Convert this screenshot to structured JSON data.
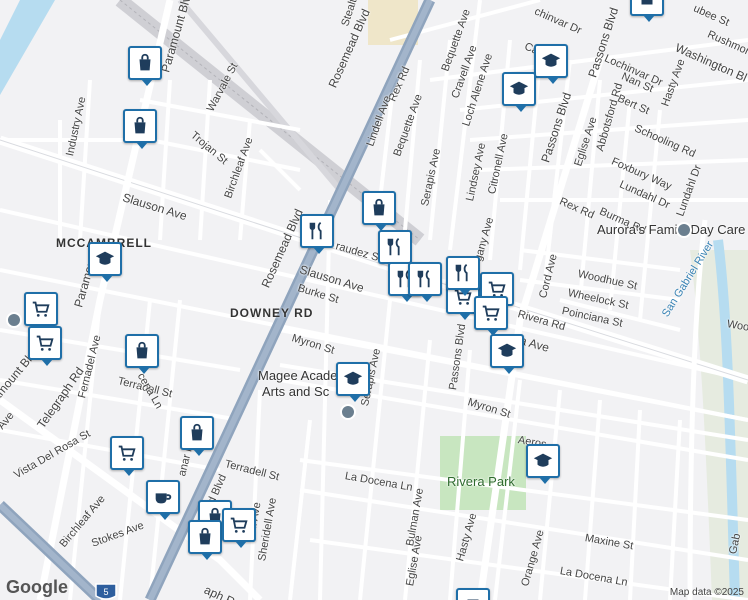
{
  "streets": {
    "rosemead_top": "Rosemead Blvd",
    "rosemead_mid": "Rosemead Blvd",
    "rosemead_bottom": "Rosemead Blvd",
    "slauson_left": "Slauson Ave",
    "slauson_right": "Slauson Ave",
    "burke": "Burke St",
    "myron_left": "Myron St",
    "myron_right": "Myron St",
    "serapis_top": "Serapis Ave",
    "serapis_mid": "Serapis Ave",
    "passons_top": "Passons Blvd",
    "passons_mid": "Passons Blvd",
    "paramount_top": "Paramount Blvd",
    "paramount_mid": "Paramount",
    "paramount_left": "ramount Blvd",
    "telegraph_left": "Telegraph Rd",
    "telegraph_bottom": "aph Rd",
    "industry": "Industry Ave",
    "warvale": "Warvale St",
    "trojan": "Trojan St",
    "birchleaf_top": "Birchleaf Ave",
    "birchleaf_bottom": "Birchleaf Ave",
    "rex_top": "Rex Rd",
    "rex_right": "Rex Rd",
    "bequette_top": "Bequette Ave",
    "bequette_mid": "Bequette Ave",
    "lindell": "Lindell Ave",
    "cravell": "Cravell Ave",
    "loch_alene": "Loch Alene Ave",
    "lindsey": "Lindsey Ave",
    "citronell": "Citronell Ave",
    "stealth": "Stealth St",
    "chinvar": "chinvar Dr",
    "lochinvar": "Lochinvar Dr",
    "nan": "Nan St",
    "bert": "Bert St",
    "hasty_top": "Hasty Ave",
    "hasty_bottom": "Hasty Ave",
    "eglise_top": "Eglise Ave",
    "eglise_bottom": "Eglise Ave",
    "abbotsford": "Abbotsford Rd",
    "schooling": "Schooling Rd",
    "foxbury": "Foxbury Way",
    "lundahl_left": "Lundahl Dr",
    "lundahl_right": "Lundahl Dr",
    "burma": "Burma Rd",
    "washington": "Washington Bl",
    "rushmore": "Rushmor",
    "dubee": "ubee St",
    "woodhue": "Woodhue St",
    "wheelock": "Wheelock St",
    "poinciana": "Poinciana St",
    "cord": "Cord Ave",
    "rivera": "Rivera Rd",
    "rivera_ave": "era Ave",
    "gany": "gany Ave",
    "raudez": "raudez St",
    "terradell_left": "Terradell St",
    "terradell_bottom": "Terradell St",
    "fernadel": "Fernadel Ave",
    "vista_del_rosa": "Vista Del Rosa St",
    "stokes": "Stokes Ave",
    "sheridell": "Sheridell Ave",
    "ell_ave": "ell Ave",
    "la_docena_left": "La Docena Ln",
    "la_docena_right": "La Docena Ln",
    "bulman": "Bulman Ave",
    "orange": "Orange Ave",
    "maxine": "Maxine St",
    "aeros": "Aeros",
    "cena": "cena Ln",
    "anar": "anar R",
    "gab": "Gab",
    "woo": "Woo",
    "san_gabriel_river": "San Gabriel River",
    "ave_left": "Ave",
    "cap": "Cap"
  },
  "areas": {
    "mccambrell": "MCCAMBRELL",
    "downey_rd": "DOWNEY RD"
  },
  "pois": {
    "magee_1": "Magee Acade",
    "magee_2": "Arts and Sc",
    "auroras": "Aurora's Family Day Care",
    "rivera_park": "Rivera Park"
  },
  "shields": {
    "i5": "5"
  },
  "branding": {
    "google": "Google",
    "attribution": "Map data ©2025"
  },
  "markers": [
    {
      "type": "shopping-bag"
    },
    {
      "type": "shopping-bag"
    },
    {
      "type": "shopping-bag"
    },
    {
      "type": "shopping-bag"
    },
    {
      "type": "shopping-bag"
    },
    {
      "type": "shopping-bag"
    },
    {
      "type": "shopping-bag"
    },
    {
      "type": "shopping-cart"
    },
    {
      "type": "shopping-cart"
    },
    {
      "type": "shopping-cart"
    },
    {
      "type": "shopping-cart"
    },
    {
      "type": "shopping-cart"
    },
    {
      "type": "shopping-cart"
    },
    {
      "type": "shopping-cart"
    },
    {
      "type": "restaurant"
    },
    {
      "type": "restaurant"
    },
    {
      "type": "restaurant"
    },
    {
      "type": "restaurant"
    },
    {
      "type": "restaurant"
    },
    {
      "type": "school"
    },
    {
      "type": "school"
    },
    {
      "type": "school"
    },
    {
      "type": "school"
    },
    {
      "type": "school"
    },
    {
      "type": "school"
    },
    {
      "type": "cafe"
    },
    {
      "type": "generic"
    }
  ],
  "colors": {
    "marker_border": "#1f6fa8",
    "park": "#c8e6c0",
    "freeway": "#8fa4bd",
    "river": "#b6dcf0"
  }
}
